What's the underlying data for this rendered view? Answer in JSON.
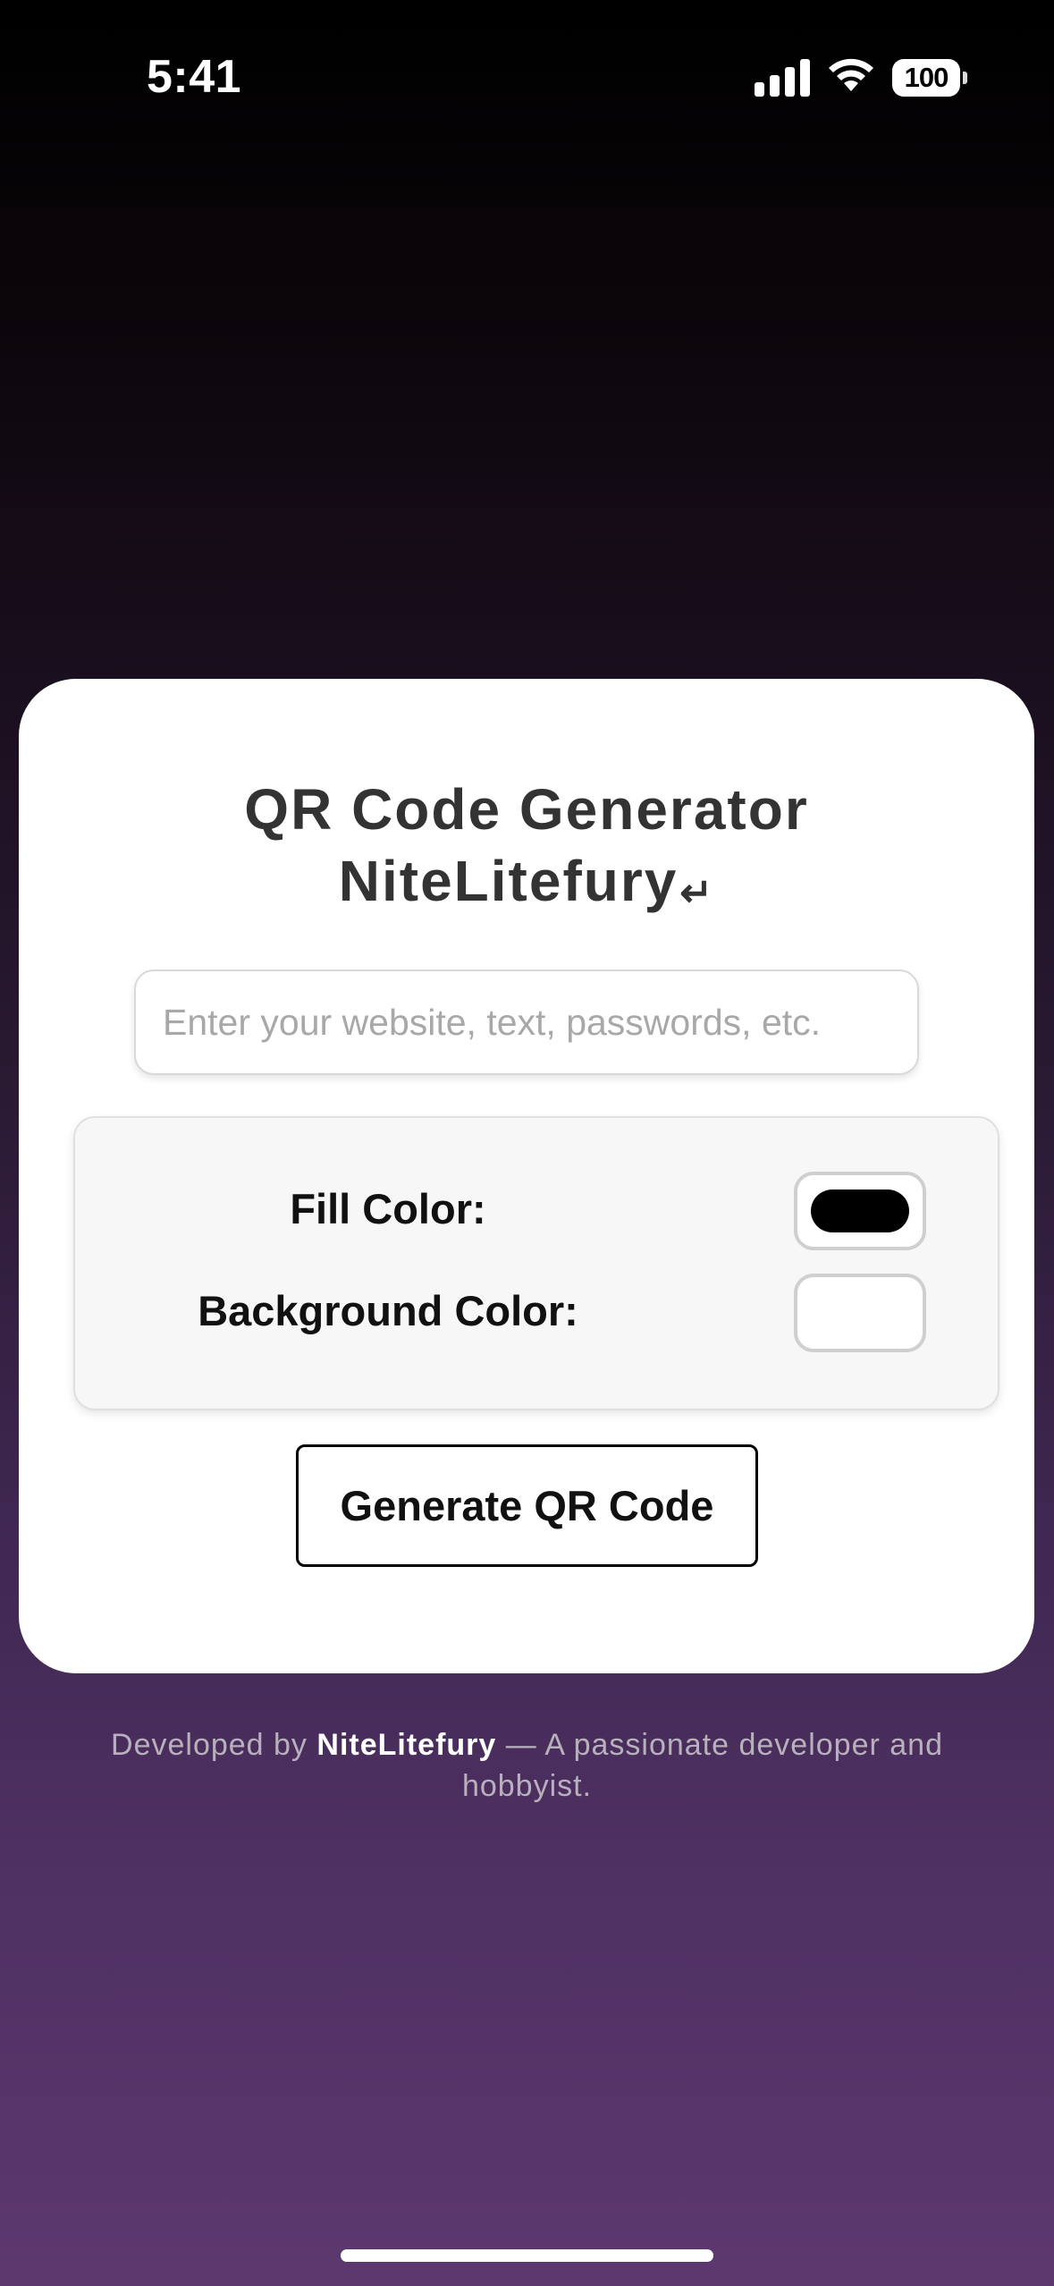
{
  "status_bar": {
    "time": "5:41",
    "battery_level": "100",
    "icons": [
      "signal-icon",
      "wifi-icon",
      "battery-icon"
    ]
  },
  "card": {
    "title_line1": "QR Code Generator",
    "title_line2": "NiteLitefury",
    "title_return_glyph": "↵",
    "input": {
      "value": "",
      "placeholder": "Enter your website, text, passwords, etc."
    },
    "options": {
      "fill_color_label": "Fill Color:",
      "fill_color_value": "#000000",
      "background_color_label": "Background Color:",
      "background_color_value": "#ffffff"
    },
    "generate_button_label": "Generate QR Code"
  },
  "footer": {
    "prefix": "Developed by ",
    "author": "NiteLitefury",
    "suffix": " — A passionate developer and hobbyist."
  },
  "colors": {
    "card_background": "#ffffff",
    "title_text": "#333333",
    "footer_text": "#b9b0bd",
    "gradient_top": "#000000",
    "gradient_bottom": "#5c386f"
  }
}
